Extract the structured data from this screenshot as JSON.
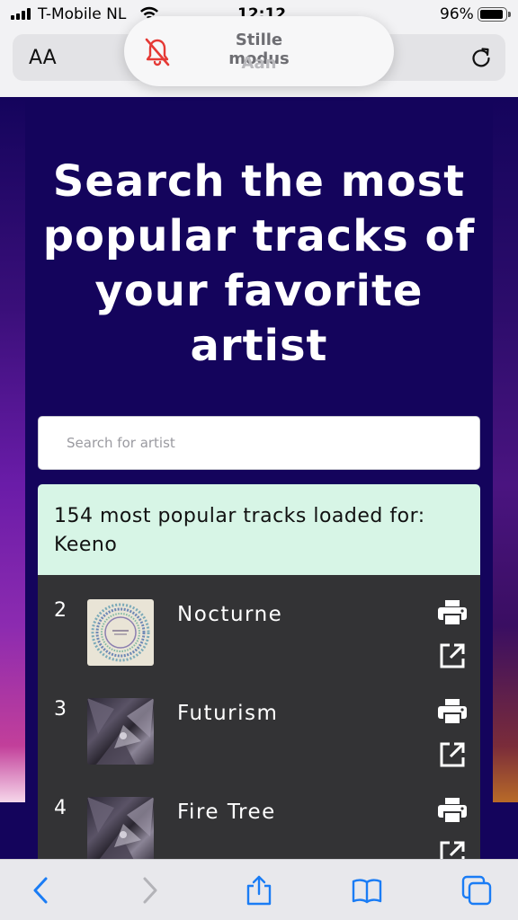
{
  "status_bar": {
    "carrier": "T-Mobile NL",
    "time": "12:12",
    "battery": "96%"
  },
  "address_bar": {
    "text_size_label": "AA"
  },
  "toast": {
    "title": "Stille modus",
    "subtitle": "Aan"
  },
  "page": {
    "headline": "Search the most popular tracks of your favorite artist",
    "search_placeholder": "Search for artist",
    "status_message": "154 most popular tracks loaded for: Keeno"
  },
  "tracks": [
    {
      "rank": "2",
      "title": "Nocturne"
    },
    {
      "rank": "3",
      "title": "Futurism"
    },
    {
      "rank": "4",
      "title": "Fire Tree"
    }
  ],
  "colors": {
    "page_background": "#14045c",
    "status_background": "#d7f5e6",
    "track_list_background": "#333335",
    "ios_blue": "#1a7cf5",
    "silent_red": "#e53935"
  }
}
